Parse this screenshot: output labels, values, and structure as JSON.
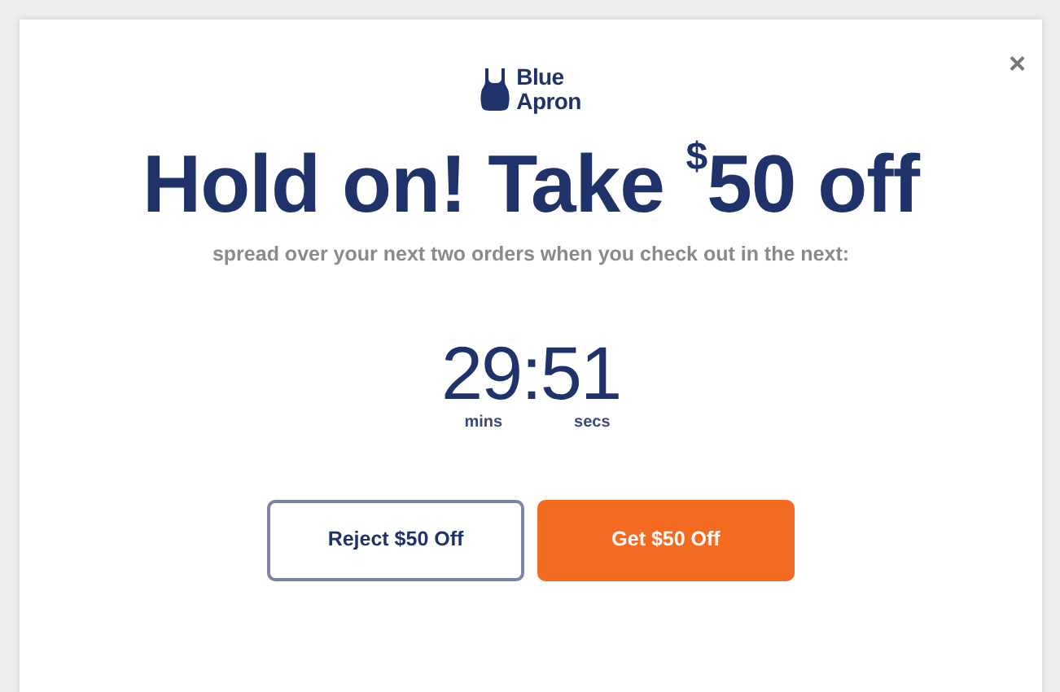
{
  "dialog": {
    "close": "×",
    "logo": {
      "line_1": "Blue",
      "line_2": "Apron"
    },
    "title": "Hold on! Take $^{$}$50 off",
    "subtitle": "spread over your next two orders when you check out in the next:",
    "timer": {
      "minutes": "29",
      "separator": ":",
      "seconds": "51",
      "minutes_label": "mins",
      "seconds_label": "secs"
    },
    "buttons": [
      {
        "label": "Reject $50 Off",
        "kind": "outline"
      },
      {
        "label": "Get $50 Off",
        "kind": "primary"
      }
    ]
  }
}
